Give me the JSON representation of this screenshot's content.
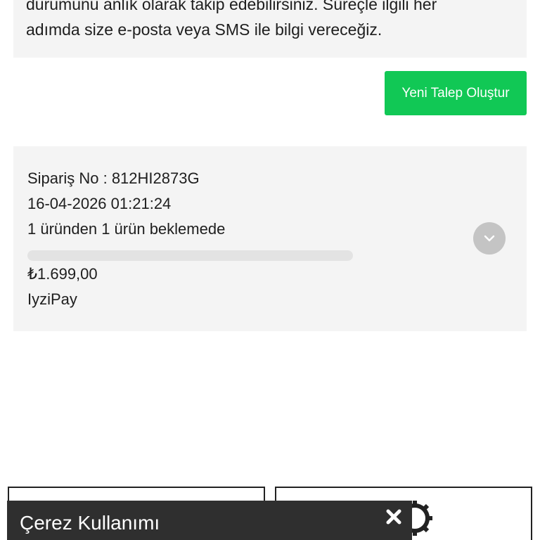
{
  "info": {
    "line1": "durumunu anlık olarak takip edebilirsiniz. Süreçle ilgili her",
    "line2": "adımda size e-posta veya SMS ile bilgi vereceğiz."
  },
  "actions": {
    "new_request_label": "Yeni Talep Oluştur"
  },
  "order": {
    "number_line": "Sipariş No : 812HI2873G",
    "datetime": "16-04-2026 01:21:24",
    "status": "1 üründen 1 ürün beklemede",
    "progress_percent": 0,
    "amount": "₺1.699,00",
    "payment_method": "IyziPay",
    "toggle_icon": "chevron-down-icon"
  },
  "cookie": {
    "title": "Çerez Kullanımı",
    "close_icon": "close-icon"
  },
  "colors": {
    "accent_green": "#11c855",
    "card_bg": "#f4f4f4",
    "cookie_bg": "#2f2f2f",
    "toggle_bg": "#c4c4c4"
  }
}
